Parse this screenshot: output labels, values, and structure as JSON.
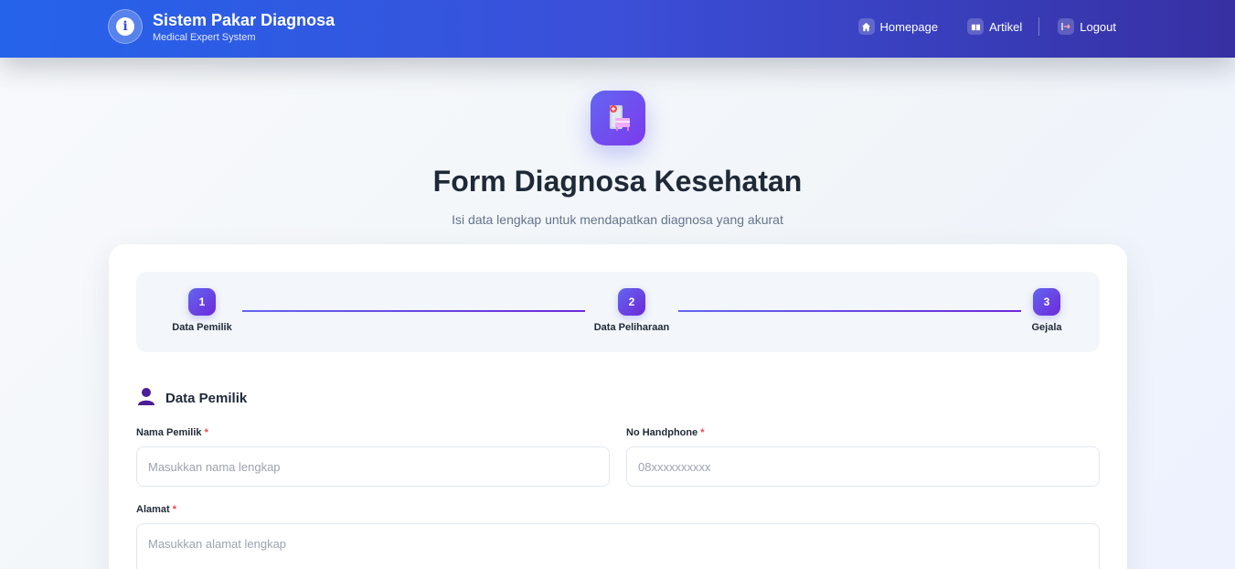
{
  "header": {
    "title": "Sistem Pakar Diagnosa",
    "subtitle": "Medical Expert System",
    "nav": [
      {
        "label": "Homepage",
        "icon": "home-icon"
      },
      {
        "label": "Artikel",
        "icon": "book-icon"
      },
      {
        "label": "Logout",
        "icon": "logout-icon"
      }
    ]
  },
  "hero": {
    "icon": "medical-clipboard-icon",
    "title": "Form Diagnosa Kesehatan",
    "subtitle": "Isi data lengkap untuk mendapatkan diagnosa yang akurat"
  },
  "stepper": [
    {
      "number": "1",
      "label": "Data Pemilik"
    },
    {
      "number": "2",
      "label": "Data Peliharaan"
    },
    {
      "number": "3",
      "label": "Gejala"
    }
  ],
  "section": {
    "icon": "user-icon",
    "title": "Data Pemilik"
  },
  "form": {
    "required_mark": "*",
    "nama": {
      "label": "Nama Pemilik",
      "placeholder": "Masukkan nama lengkap",
      "value": ""
    },
    "phone": {
      "label": "No Handphone",
      "placeholder": "08xxxxxxxxxx",
      "value": ""
    },
    "alamat": {
      "label": "Alamat",
      "placeholder": "Masukkan alamat lengkap",
      "value": ""
    }
  },
  "colors": {
    "header_start": "#2563eb",
    "header_end": "#3730a3",
    "accent": "#6366f1",
    "accent_dark": "#6d28d9",
    "required": "#ef4444"
  }
}
